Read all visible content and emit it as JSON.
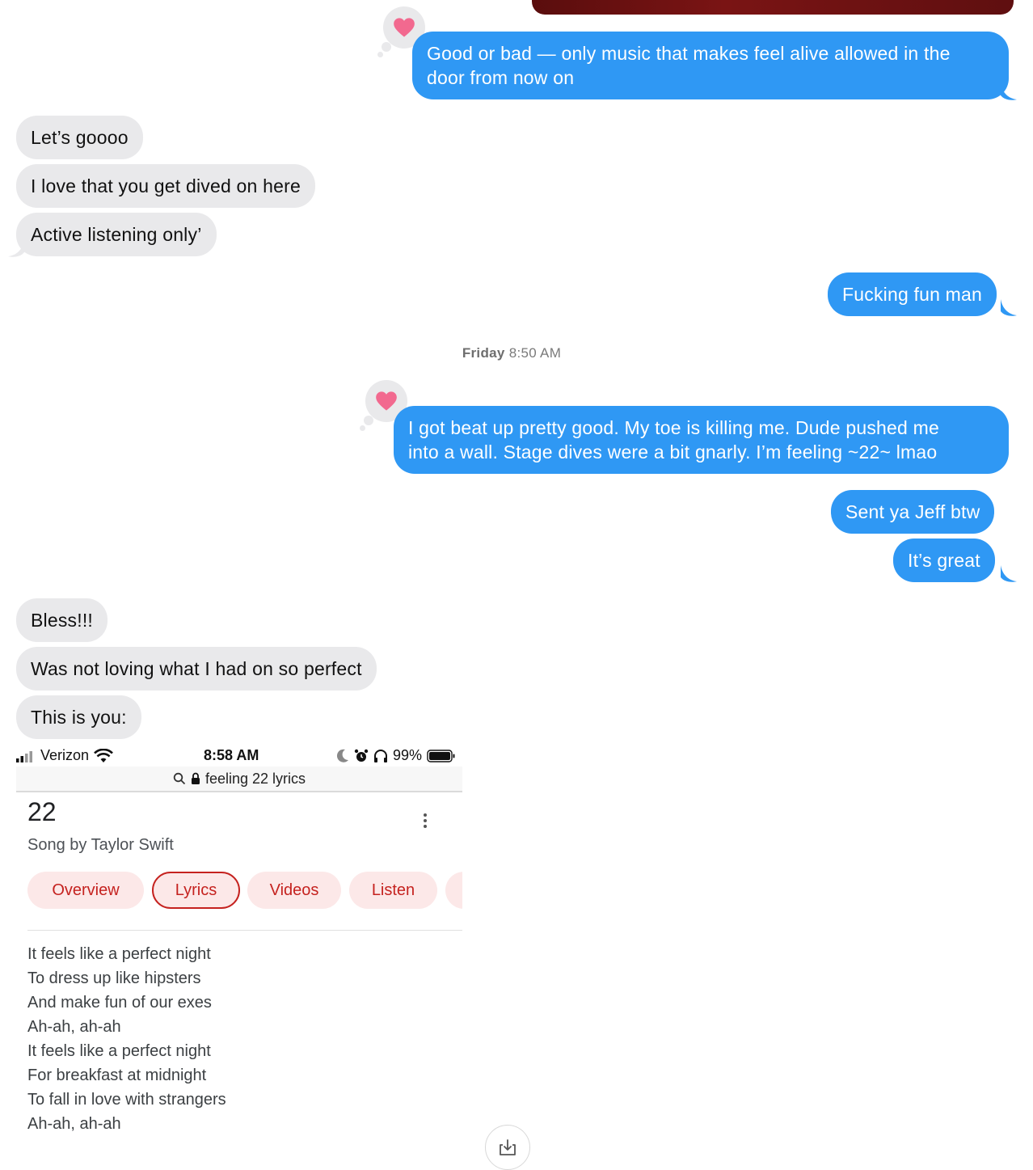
{
  "messages": {
    "m1": "Good or bad — only music that makes feel alive allowed in the",
    "m1b": "door from now on",
    "m2": "Let’s goooo",
    "m3": "I love that you get dived on here",
    "m4": "Active listening only’",
    "m5": "Fucking fun man",
    "m6": "I got beat up pretty good. My toe is killing me. Dude pushed me",
    "m6b": "into a wall. Stage dives were a bit gnarly. I’m feeling ~22~ lmao",
    "m7": "Sent ya Jeff btw",
    "m8": "It’s great",
    "m9": "Bless!!!",
    "m10": "Was not loving what I had on so perfect",
    "m11": "This is you:"
  },
  "timestamp": {
    "day": "Friday",
    "time": "8:50 AM"
  },
  "attachment": {
    "carrier": "Verizon",
    "time": "8:58 AM",
    "battery": "99%",
    "url": "feeling 22 lyrics",
    "title": "22",
    "subtitle": "Song by Taylor Swift",
    "chips": [
      "Overview",
      "Lyrics",
      "Videos",
      "Listen"
    ],
    "lyrics": [
      "It feels like a perfect night",
      "To dress up like hipsters",
      "And make fun of our exes",
      "Ah-ah, ah-ah",
      "It feels like a perfect night",
      "For breakfast at midnight",
      "To fall in love with strangers",
      "Ah-ah, ah-ah"
    ]
  },
  "colors": {
    "outgoing": "#2f98f4",
    "incoming": "#e9e9eb",
    "heart": "#f2698f",
    "chip_text": "#c5221f"
  },
  "icons": [
    "heart-tapback-icon",
    "wifi-icon",
    "signal-icon",
    "moon-icon",
    "alarm-icon",
    "headphones-icon",
    "battery-icon",
    "search-icon",
    "lock-icon",
    "more-vert-icon",
    "download-icon"
  ]
}
